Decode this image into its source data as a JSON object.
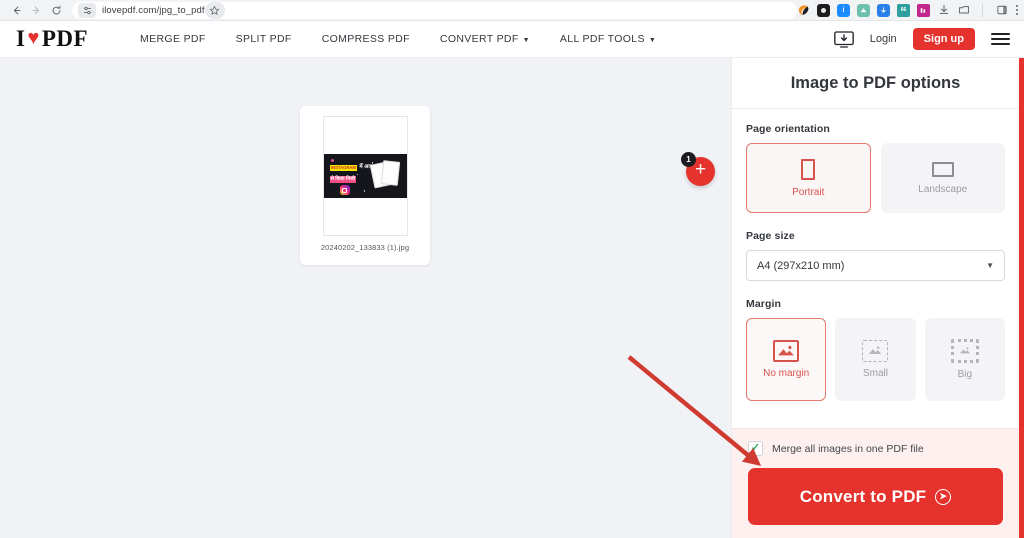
{
  "browser": {
    "back_icon": "back-arrow-icon",
    "forward_icon": "forward-arrow-icon",
    "reload_icon": "reload-icon",
    "url": "ilovepdf.com/jpg_to_pdf",
    "bookmark_icon": "star-icon",
    "extensions": [
      {
        "name": "grammarly-extension-icon",
        "color": "#f0a340"
      },
      {
        "name": "dark-square-extension-icon",
        "color": "#1d1d1f"
      },
      {
        "name": "info-extension-icon",
        "color": "#1a8cff"
      },
      {
        "name": "teal-extension-icon",
        "color": "#5fb3a1"
      },
      {
        "name": "blue-download-extension-icon",
        "color": "#2a7fe8"
      },
      {
        "name": "calculator-extension-icon",
        "color": "#3aa8a0"
      },
      {
        "name": "magenta-extension-icon",
        "color": "#c2278e"
      },
      {
        "name": "downloads-icon",
        "color": "#5f6368"
      },
      {
        "name": "tab-group-icon",
        "color": "#5f6368"
      }
    ],
    "side_panel_icon": "side-panel-icon",
    "menu_icon": "kebab-menu-icon"
  },
  "site_nav": {
    "logo_i": "I",
    "logo_heart": "♥",
    "logo_pdf": "PDF",
    "links": [
      {
        "label": "MERGE PDF",
        "has_caret": false
      },
      {
        "label": "SPLIT PDF",
        "has_caret": false
      },
      {
        "label": "COMPRESS PDF",
        "has_caret": false
      },
      {
        "label": "CONVERT PDF",
        "has_caret": true
      },
      {
        "label": "ALL PDF TOOLS",
        "has_caret": true
      }
    ],
    "desktop_icon": "desktop-download-icon",
    "login_label": "Login",
    "signup_label": "Sign up",
    "menu_icon": "hamburger-menu-icon"
  },
  "workspace": {
    "file": {
      "name": "20240202_133833 (1).jpg",
      "thumbnail": {
        "banner_line1_highlight": "INSTAGRAM",
        "banner_line1_rest": "में आप",
        "banner_line2": "से किया निजी",
        "instagram_icon": "instagram-logo-icon"
      }
    },
    "add_file_button": {
      "icon": "plus-icon",
      "count": "1"
    },
    "annotation": {
      "type": "arrow",
      "color": "#cf3a31"
    }
  },
  "options_panel": {
    "title": "Image to PDF options",
    "page_orientation": {
      "label": "Page orientation",
      "options": [
        {
          "label": "Portrait",
          "icon": "portrait-rect-icon",
          "selected": true
        },
        {
          "label": "Landscape",
          "icon": "landscape-rect-icon",
          "selected": false
        }
      ]
    },
    "page_size": {
      "label": "Page size",
      "value": "A4 (297x210 mm)",
      "caret_icon": "chevron-down-icon"
    },
    "margin": {
      "label": "Margin",
      "options": [
        {
          "label": "No margin",
          "icon": "image-no-margin-icon",
          "selected": true
        },
        {
          "label": "Small",
          "icon": "image-small-margin-icon",
          "selected": false
        },
        {
          "label": "Big",
          "icon": "image-big-margin-icon",
          "selected": false
        }
      ]
    },
    "merge": {
      "label": "Merge all images in one PDF file",
      "checked": true,
      "check_icon": "check-icon"
    },
    "convert_button": {
      "label": "Convert to PDF",
      "icon": "arrow-circle-right-icon"
    }
  },
  "colors": {
    "brand_red": "#e5322d",
    "workspace_bg": "#f1f2f6",
    "footer_bg": "#fdf0ef",
    "selected_border": "#e5776f",
    "selected_text": "#d8534c",
    "check_green": "#2faa5f"
  }
}
